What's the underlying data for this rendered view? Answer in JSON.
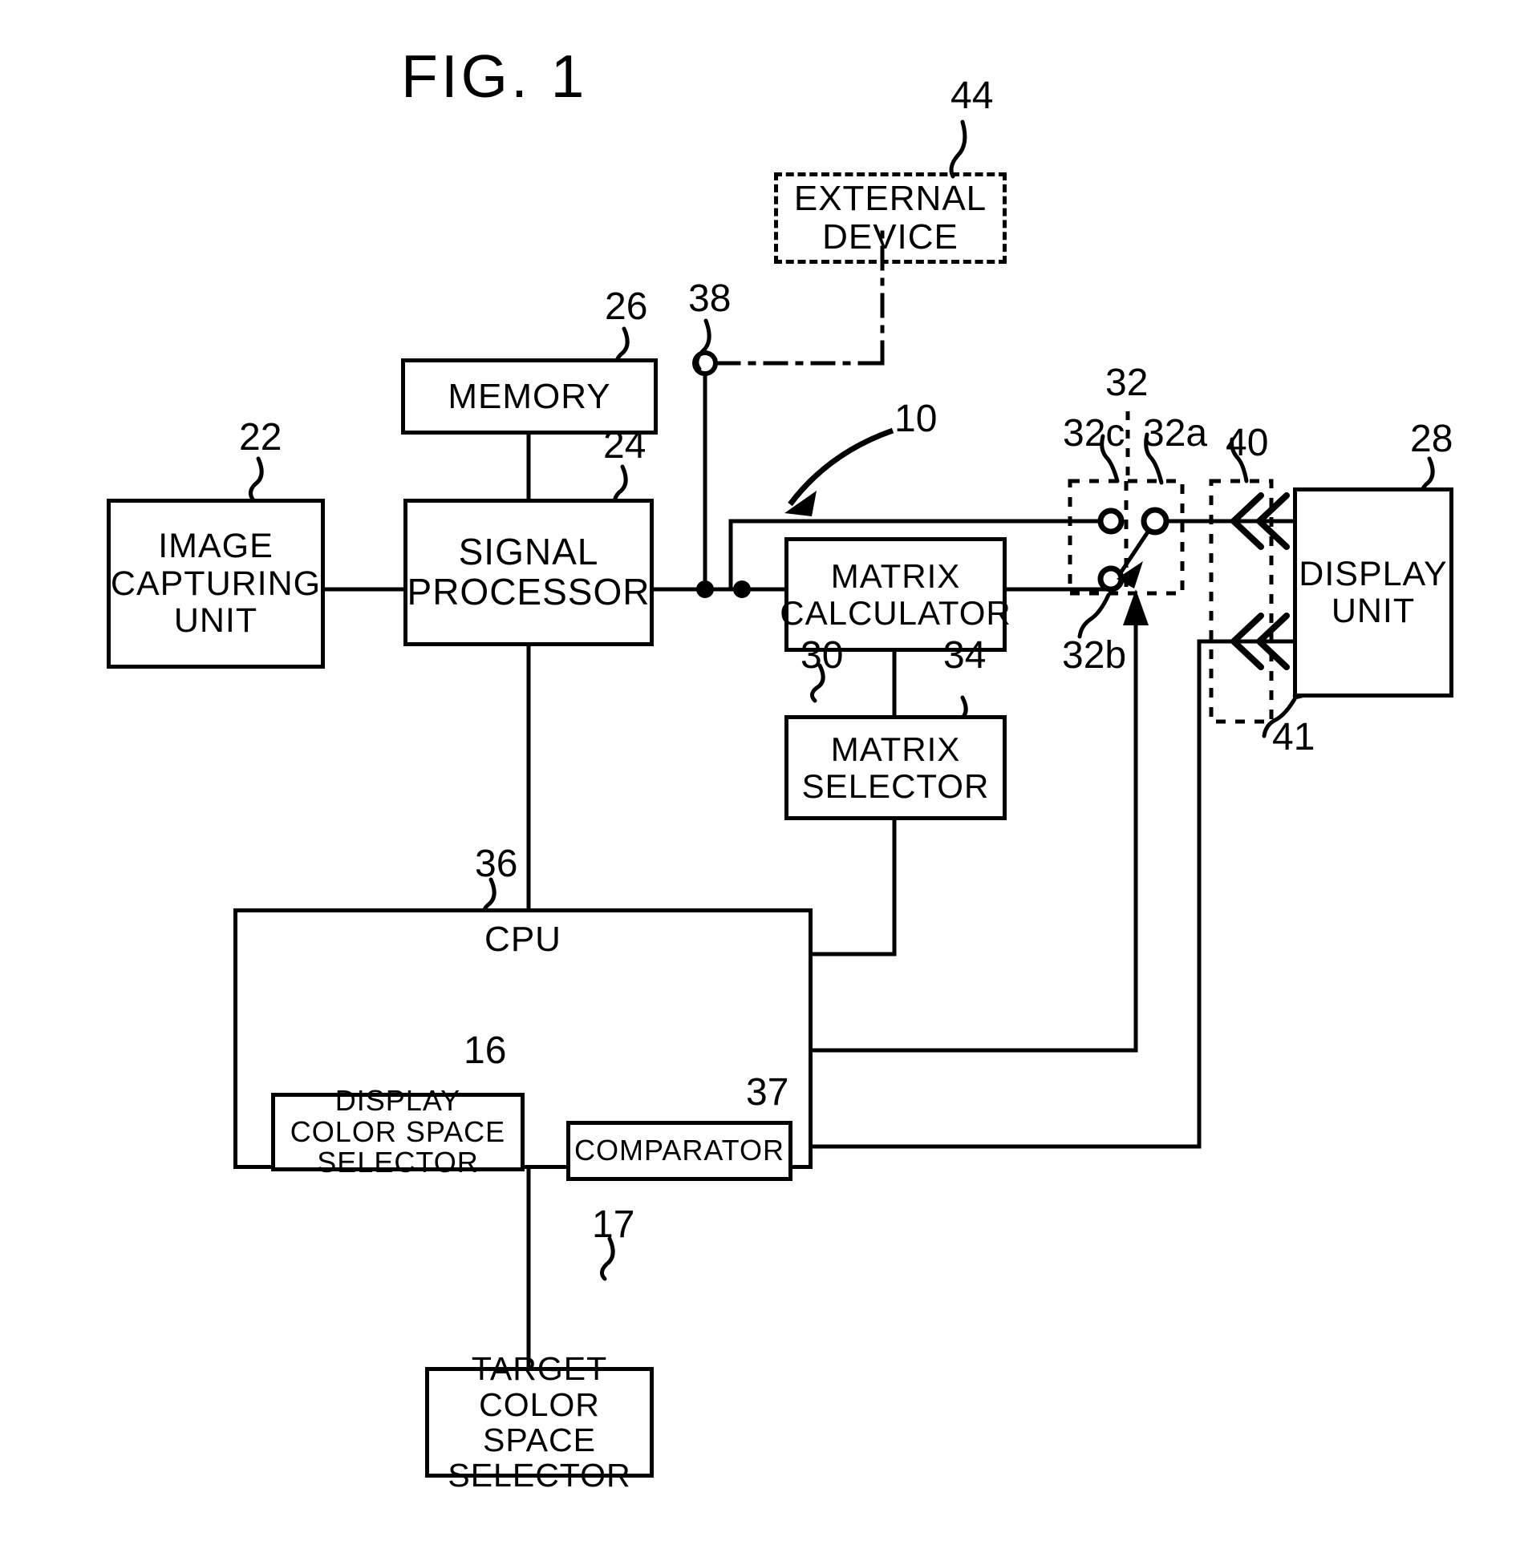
{
  "figure": {
    "title": "FIG. 1",
    "kind": "patent-block-diagram",
    "line_color": "#000000",
    "background": "#ffffff"
  },
  "blocks": [
    {
      "id": "external-device",
      "ref": "44",
      "lines": [
        "EXTERNAL",
        "DEVICE"
      ],
      "border": "dash-dot"
    },
    {
      "id": "memory",
      "ref": "26",
      "lines": [
        "MEMORY"
      ],
      "border": "solid"
    },
    {
      "id": "image-capturing-unit",
      "ref": "22",
      "lines": [
        "IMAGE",
        "CAPTURING",
        "UNIT"
      ],
      "border": "solid"
    },
    {
      "id": "signal-processor",
      "ref": "24",
      "lines": [
        "SIGNAL",
        "PROCESSOR"
      ],
      "border": "solid"
    },
    {
      "id": "matrix-calculator",
      "ref": "30",
      "lines": [
        "MATRIX",
        "CALCULATOR"
      ],
      "border": "solid"
    },
    {
      "id": "matrix-selector",
      "ref": "34",
      "lines": [
        "MATRIX",
        "SELECTOR"
      ],
      "border": "solid"
    },
    {
      "id": "display-unit",
      "ref": "28",
      "lines": [
        "DISPLAY",
        "UNIT"
      ],
      "border": "solid"
    },
    {
      "id": "cpu",
      "ref": "36",
      "lines": [
        "CPU"
      ],
      "border": "solid"
    },
    {
      "id": "display-color-space-selector",
      "ref": "16",
      "lines": [
        "DISPLAY",
        "COLOR SPACE",
        "SELECTOR"
      ],
      "border": "solid"
    },
    {
      "id": "comparator",
      "ref": "37",
      "lines": [
        "COMPARATOR"
      ],
      "border": "solid"
    },
    {
      "id": "target-color-space-selector",
      "ref": "17",
      "lines": [
        "TARGET",
        "COLOR",
        "SPACE",
        "SELECTOR"
      ],
      "border": "solid"
    }
  ],
  "reference_numerals": {
    "apparatus": "10",
    "display_color_space_selector": "16",
    "target_color_space_selector": "17",
    "image_capturing_unit": "22",
    "signal_processor": "24",
    "memory": "26",
    "display_unit": "28",
    "matrix_calculator": "30",
    "switch": "32",
    "switch_contact_a": "32a",
    "switch_contact_b": "32b",
    "switch_contact_c": "32c",
    "matrix_selector": "34",
    "cpu": "36",
    "comparator": "37",
    "terminal": "38",
    "input_selector": "40",
    "display_input": "41",
    "external_device": "44"
  },
  "labels": {
    "fig_title": "FIG. 1",
    "apparatus": "10",
    "terminal_38": "38",
    "switch_32": "32",
    "switch_32a": "32a",
    "switch_32b": "32b",
    "switch_32c": "32c",
    "sel_40": "40",
    "disp_41": "41",
    "ext_44": "44",
    "memory_26": "26",
    "image_22": "22",
    "signal_24": "24",
    "matrix_calc_30": "30",
    "matrix_sel_34": "34",
    "display_28": "28",
    "cpu_36": "36",
    "dcss_16": "16",
    "comparator_37": "37",
    "tcss_17": "17",
    "cpu_text": "CPU"
  },
  "block_text": {
    "external_device_1": "EXTERNAL",
    "external_device_2": "DEVICE",
    "memory_1": "MEMORY",
    "image_1": "IMAGE",
    "image_2": "CAPTURING",
    "image_3": "UNIT",
    "signal_1": "SIGNAL",
    "signal_2": "PROCESSOR",
    "matrix_calc_1": "MATRIX",
    "matrix_calc_2": "CALCULATOR",
    "matrix_sel_1": "MATRIX",
    "matrix_sel_2": "SELECTOR",
    "display_1": "DISPLAY",
    "display_2": "UNIT",
    "dcss_1": "DISPLAY",
    "dcss_2": "COLOR SPACE",
    "dcss_3": "SELECTOR",
    "comparator_1": "COMPARATOR",
    "tcss_1": "TARGET",
    "tcss_2": "COLOR",
    "tcss_3": "SPACE",
    "tcss_4": "SELECTOR"
  }
}
